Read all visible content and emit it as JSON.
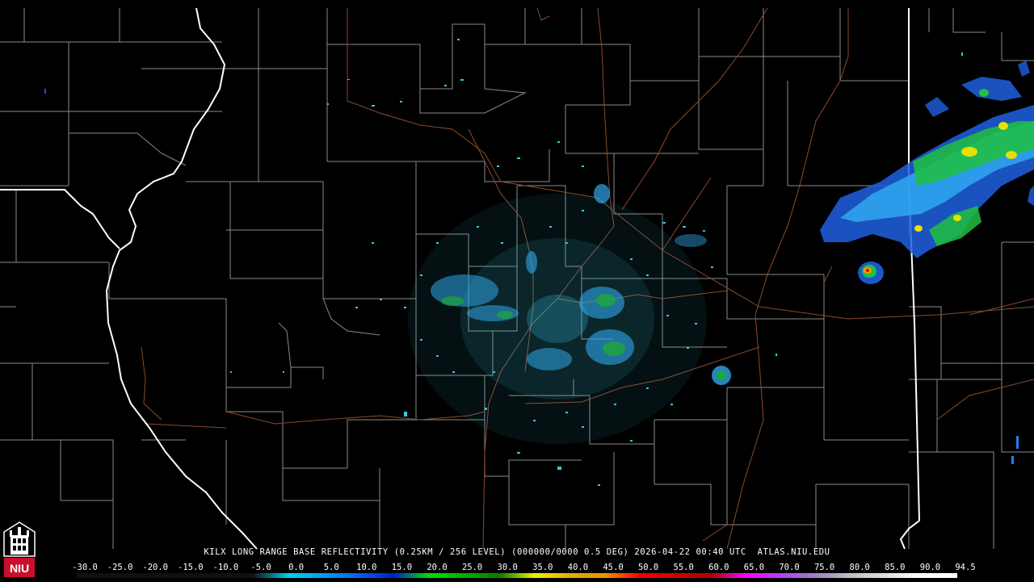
{
  "product": {
    "title": "KILX LONG RANGE BASE REFLECTIVITY (0.25KM / 256 LEVEL) (000000/0000 0.5 DEG) 2026-04-22 00:40 UTC  ATLAS.NIU.EDU"
  },
  "legend": {
    "labels": [
      "-30.0",
      "-25.0",
      "-20.0",
      "-15.0",
      "-10.0",
      "-5.0",
      "0.0",
      "5.0",
      "10.0",
      "15.0",
      "20.0",
      "25.0",
      "30.0",
      "35.0",
      "40.0",
      "45.0",
      "50.0",
      "55.0",
      "60.0",
      "65.0",
      "70.0",
      "75.0",
      "80.0",
      "85.0",
      "90.0",
      "94.5"
    ],
    "colors": [
      "#101010",
      "#101010",
      "#101010",
      "#101010",
      "#101010",
      "#101010",
      "#00d0f0",
      "#00a0f0",
      "#0060f0",
      "#0020d0",
      "#00e000",
      "#00b000",
      "#008000",
      "#f0f000",
      "#e0b000",
      "#f09000",
      "#f00000",
      "#d00000",
      "#b00000",
      "#ff00ff",
      "#b040ff",
      "#a080c0",
      "#c0c0c0",
      "#e0e0e0",
      "#ffffff",
      "#ffffff"
    ]
  },
  "logo": {
    "text": "NIU",
    "color": "#c8102e"
  },
  "map": {
    "radar_site": "KILX",
    "colors": {
      "county_lines": "#8a8a8a",
      "state_lines": "#ffffff",
      "highways": "#8b4a2c",
      "background": "#000000"
    }
  }
}
